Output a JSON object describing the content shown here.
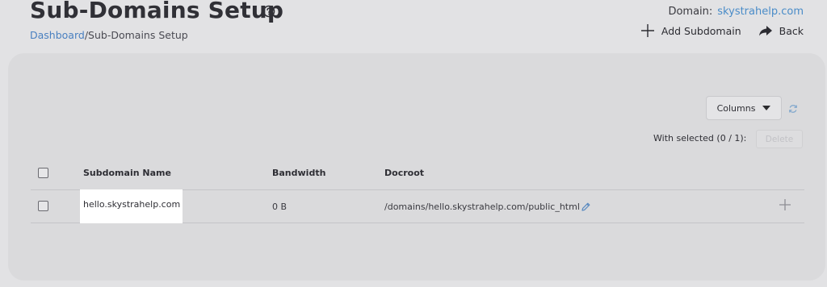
{
  "page": {
    "title": "Sub-Domains Setup",
    "icon": "help-circle-icon"
  },
  "breadcrumb": {
    "home": "Dashboard",
    "separator": "/",
    "current": "Sub-Domains Setup"
  },
  "domain": {
    "label": "Domain:",
    "value": "skystrahelp.com"
  },
  "actions": {
    "add_subdomain": "Add Subdomain",
    "back": "Back"
  },
  "toolbar": {
    "columns_label": "Columns",
    "with_selected": "With selected (0 / 1):",
    "delete_label": "Delete"
  },
  "table": {
    "columns": [
      "Subdomain Name",
      "Bandwidth",
      "Docroot"
    ],
    "rows": [
      {
        "name": "hello.skystrahelp.com",
        "bandwidth": "0 B",
        "docroot": "/domains/hello.skystrahelp.com/public_html"
      }
    ]
  },
  "colors": {
    "link": "#4a80c0",
    "background": "#e2e2e4",
    "card": "#dadadc",
    "highlight": "#ffffff"
  }
}
